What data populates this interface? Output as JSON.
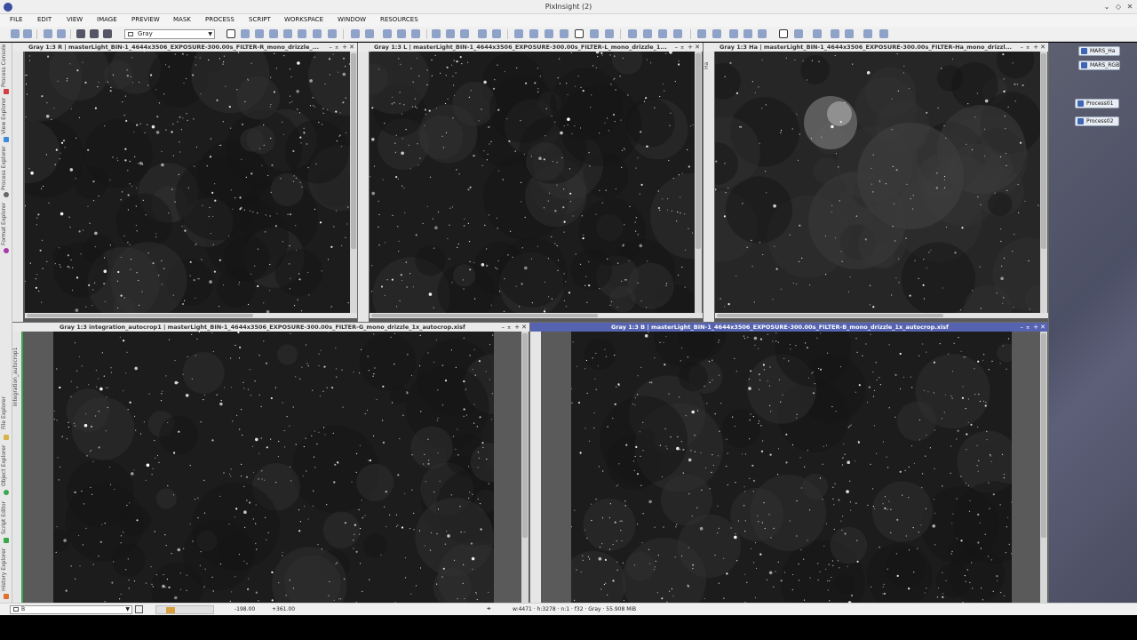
{
  "app": {
    "title": "PixInsight (2)"
  },
  "window_controls": [
    "minimize-icon",
    "restore-icon",
    "close-icon"
  ],
  "menu": [
    "FILE",
    "EDIT",
    "VIEW",
    "IMAGE",
    "PREVIEW",
    "MASK",
    "PROCESS",
    "SCRIPT",
    "WORKSPACE",
    "WINDOW",
    "RESOURCES"
  ],
  "toolbar": {
    "view_select": "Gray"
  },
  "left_tabs": [
    "Process Console",
    "View Explorer",
    "Process Explorer",
    "Format Explorer",
    "File Explorer",
    "Object Explorer",
    "Script Editor",
    "History Explorer"
  ],
  "windows": [
    {
      "id": "R",
      "title": "Gray 1:3 R | masterLight_BIN-1_4644x3506_EXPOSURE-300.00s_FILTER-R_mono_drizzle_...",
      "side_label": "",
      "active": false
    },
    {
      "id": "L",
      "title": "Gray 1:3 L | masterLight_BIN-1_4644x3506_EXPOSURE-300.00s_FILTER-L_mono_drizzle_1...",
      "side_label": "",
      "active": false
    },
    {
      "id": "Ha",
      "title": "Gray 1:3 Ha | masterLight_BIN-1_4644x3506_EXPOSURE-300.00s_FILTER-Ha_mono_drizzl...",
      "side_label": "Ha",
      "active": false
    },
    {
      "id": "G",
      "title": "Gray 1:3 integration_autocrop1 | masterLight_BIN-1_4644x3506_EXPOSURE-300.00s_FILTER-G_mono_drizzle_1x_autocrop.xisf",
      "side_label": "integration_autocrop1",
      "active": false
    },
    {
      "id": "B",
      "title": "Gray 1:3 B | masterLight_BIN-1_4644x3506_EXPOSURE-300.00s_FILTER-B_mono_drizzle_1x_autocrop.xisf",
      "side_label": "",
      "active": true
    }
  ],
  "icons_right": {
    "images": [
      "MARS_Ha",
      "MARS_RGB"
    ],
    "processes": [
      "Process01",
      "Process02"
    ]
  },
  "status": {
    "view_select": "B",
    "coord_x": "-198.00",
    "coord_y": "+361.00",
    "image_info": "w:4471 · h:3278 · n:1 · f32 · Gray · 55.908 MiB"
  }
}
